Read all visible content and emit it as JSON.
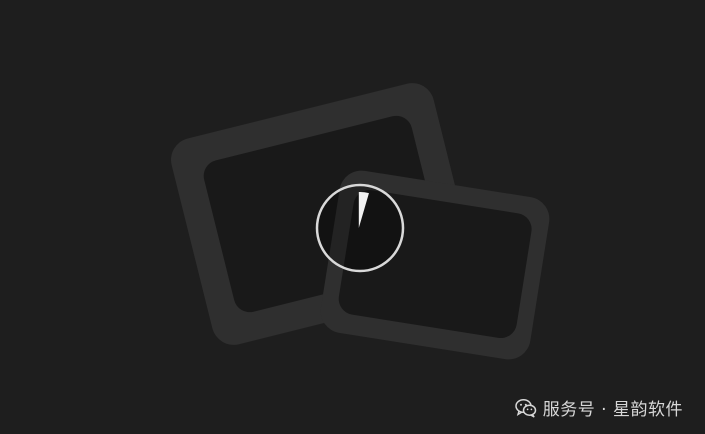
{
  "loading": {
    "progress": 0.04
  },
  "watermark": {
    "icon": "wechat-icon",
    "text": "服务号 · 星韵软件"
  },
  "colors": {
    "background": "#1e1e1e",
    "frame": "#2f2f2f",
    "frame_inner": "#191919",
    "ring": "#d9d9d9",
    "ring_fill": "#f2f2f2"
  }
}
